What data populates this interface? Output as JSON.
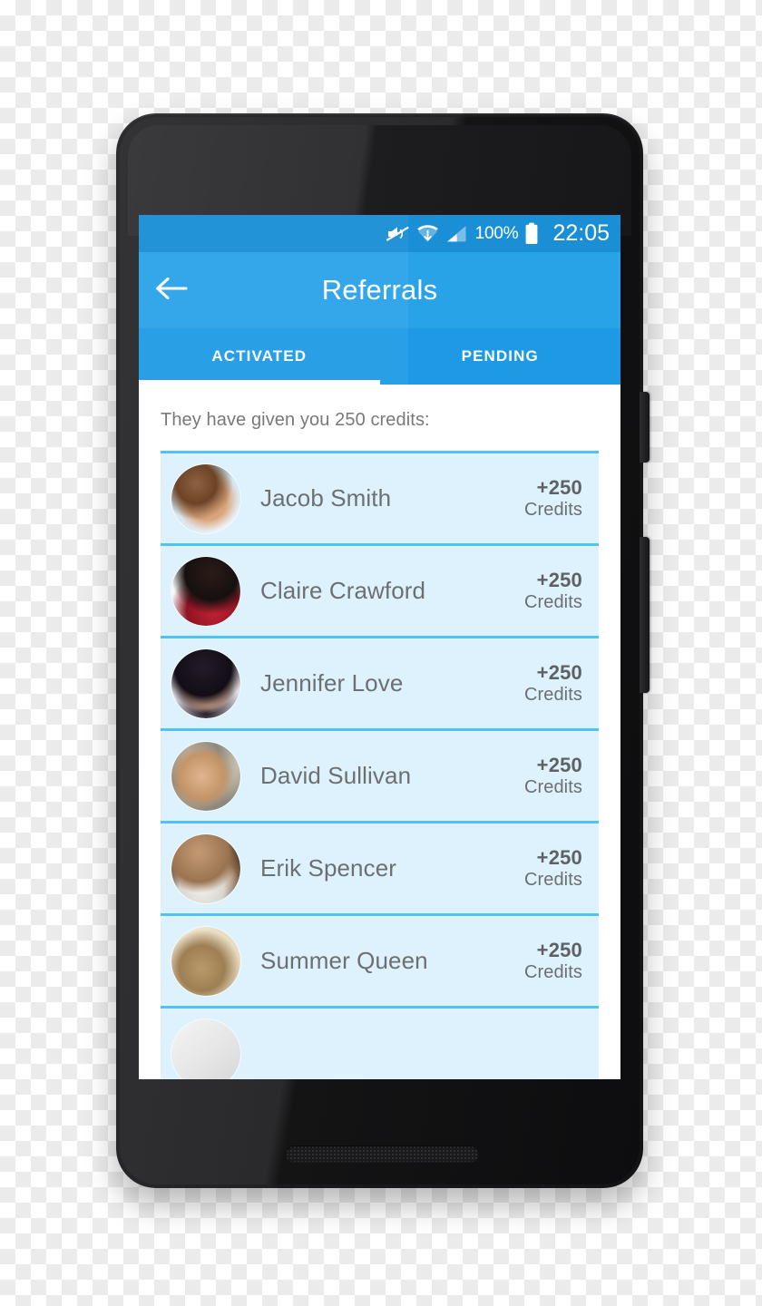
{
  "status_bar": {
    "mute_icon": "mute-icon",
    "wifi_icon": "wifi-icon",
    "signal_icon": "signal-icon",
    "battery_icon": "battery-icon",
    "battery_percent": "100%",
    "clock": "22:05"
  },
  "toolbar": {
    "back_icon": "back-arrow-icon",
    "title": "Referrals"
  },
  "tabs": {
    "items": [
      {
        "label": "ACTIVATED",
        "active": true
      },
      {
        "label": "PENDING",
        "active": false
      }
    ]
  },
  "content": {
    "subtitle": "They have given you 250 credits:",
    "referrals": [
      {
        "name": "Jacob Smith",
        "amount": "+250",
        "unit": "Credits",
        "avatar": "man-in-bed-photo"
      },
      {
        "name": "Claire Crawford",
        "amount": "+250",
        "unit": "Credits",
        "avatar": "woman-red-top-photo"
      },
      {
        "name": "Jennifer Love",
        "amount": "+250",
        "unit": "Credits",
        "avatar": "woman-dark-hair-photo"
      },
      {
        "name": "David Sullivan",
        "amount": "+250",
        "unit": "Credits",
        "avatar": "man-on-rocks-photo"
      },
      {
        "name": "Erik Spencer",
        "amount": "+250",
        "unit": "Credits",
        "avatar": "man-white-tank-photo"
      },
      {
        "name": "Summer Queen",
        "amount": "+250",
        "unit": "Credits",
        "avatar": "woman-long-hair-photo"
      },
      {
        "name": "",
        "amount": "",
        "unit": "",
        "avatar": "partial-avatar-photo"
      }
    ]
  },
  "colors": {
    "status_bar": "#1a8fd6",
    "toolbar": "#29a3e8",
    "tab_bar": "#1e9ae4",
    "tab_indicator": "#ffffff",
    "row_background": "#ddf2fd",
    "row_divider": "#4fc3f5",
    "text_primary": "#6d6f71",
    "screen_background": "#ffffff"
  },
  "device": {
    "body_color": "#202023",
    "hardware": [
      "front-camera",
      "earpiece-speaker",
      "power-button",
      "volume-button",
      "bottom-speaker"
    ]
  }
}
